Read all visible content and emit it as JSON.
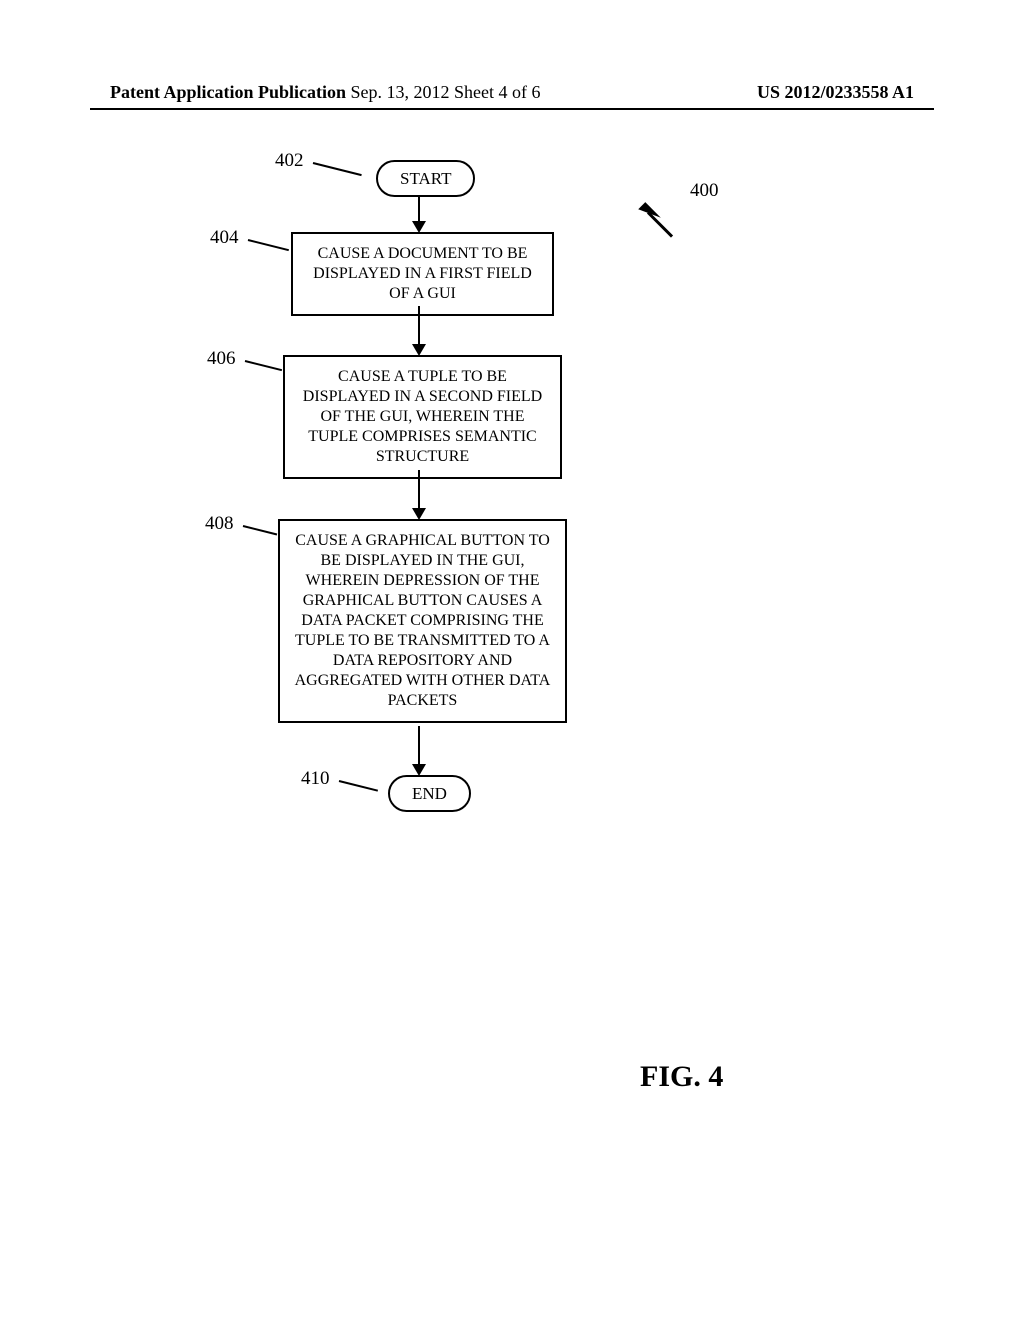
{
  "header": {
    "left": "Patent Application Publication",
    "mid": "Sep. 13, 2012   Sheet 4 of 6",
    "right": "US 2012/0233558 A1"
  },
  "figure_label": "FIG. 4",
  "ref": {
    "overall": "400",
    "start": "402",
    "box1": "404",
    "box2": "406",
    "box3": "408",
    "end": "410"
  },
  "flow": {
    "start": "START",
    "box1": "CAUSE A DOCUMENT TO BE DISPLAYED IN A FIRST FIELD OF A GUI",
    "box2": "CAUSE A TUPLE TO BE DISPLAYED IN A SECOND FIELD OF THE GUI, WHEREIN THE TUPLE COMPRISES SEMANTIC STRUCTURE",
    "box3": "CAUSE A GRAPHICAL BUTTON TO BE DISPLAYED IN THE GUI, WHEREIN DEPRESSION OF THE GRAPHICAL BUTTON CAUSES A DATA PACKET COMPRISING THE TUPLE TO BE TRANSMITTED TO A DATA REPOSITORY AND AGGREGATED WITH OTHER DATA PACKETS",
    "end": "END"
  }
}
